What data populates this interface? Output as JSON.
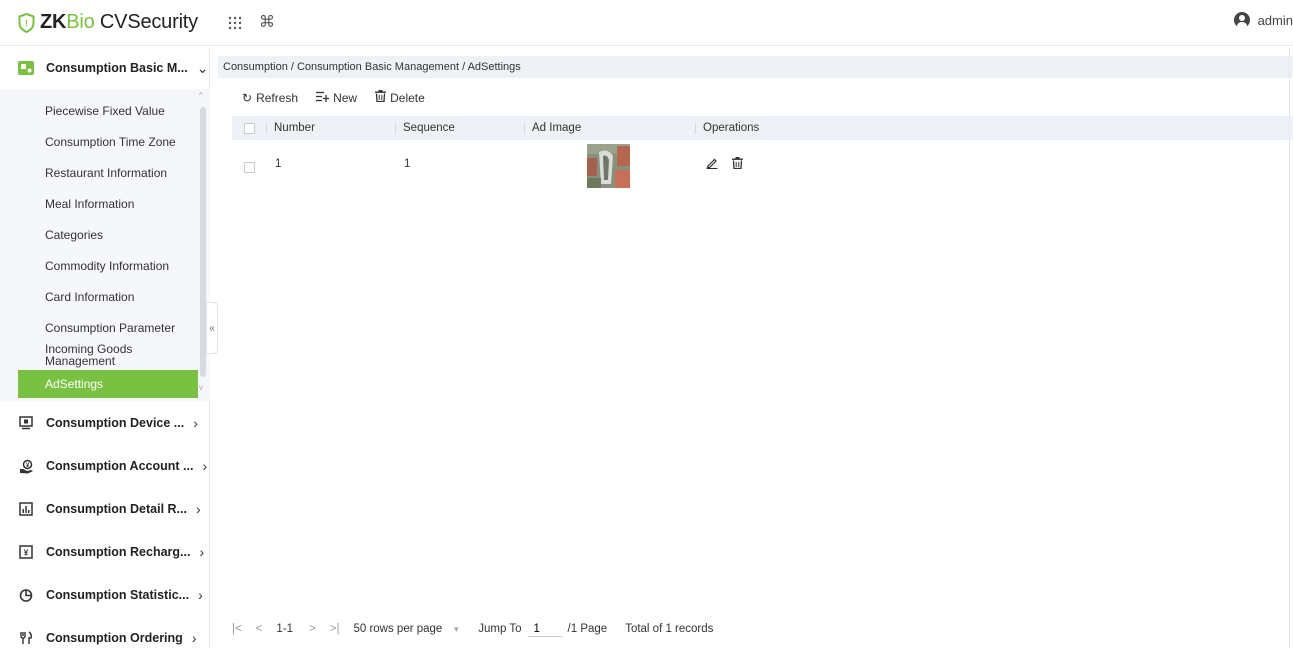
{
  "header": {
    "brand_zk": "ZK",
    "brand_bio": "Bio",
    "brand_cv": " CVSecurity",
    "apps_icon": "grid-icon",
    "shortcut_icon": "command-icon",
    "user_name": "admin",
    "accent": "#7ac143"
  },
  "sidebar": {
    "expanded_group": "Consumption Basic M...",
    "sub_items": [
      "Piecewise Fixed Value",
      "Consumption Time Zone",
      "Restaurant Information",
      "Meal Information",
      "Categories",
      "Commodity Information",
      "Card Information",
      "Consumption Parameter",
      "Incoming Goods Management",
      "AdSettings"
    ],
    "active_item": "AdSettings",
    "groups": [
      {
        "label": "Consumption Device ...",
        "icon": "monitor-icon"
      },
      {
        "label": "Consumption Account ...",
        "icon": "account-icon"
      },
      {
        "label": "Consumption Detail R...",
        "icon": "bar-chart-icon"
      },
      {
        "label": "Consumption Recharg...",
        "icon": "recharge-icon"
      },
      {
        "label": "Consumption Statistic...",
        "icon": "pie-chart-icon"
      },
      {
        "label": "Consumption Ordering",
        "icon": "cutlery-icon"
      }
    ]
  },
  "breadcrumb": "Consumption / Consumption Basic Management / AdSettings",
  "toolbar": {
    "refresh": "Refresh",
    "new": "New",
    "delete": "Delete"
  },
  "table": {
    "columns": [
      "Number",
      "Sequence",
      "Ad Image",
      "Operations"
    ],
    "rows": [
      {
        "number": "1",
        "sequence": "1"
      }
    ]
  },
  "pagination": {
    "range": "1-1",
    "rows_per_page": "50 rows per page",
    "jump_label": "Jump To",
    "jump_value": "1",
    "page_total": "/1 Page",
    "total_records": "Total of 1 records"
  }
}
